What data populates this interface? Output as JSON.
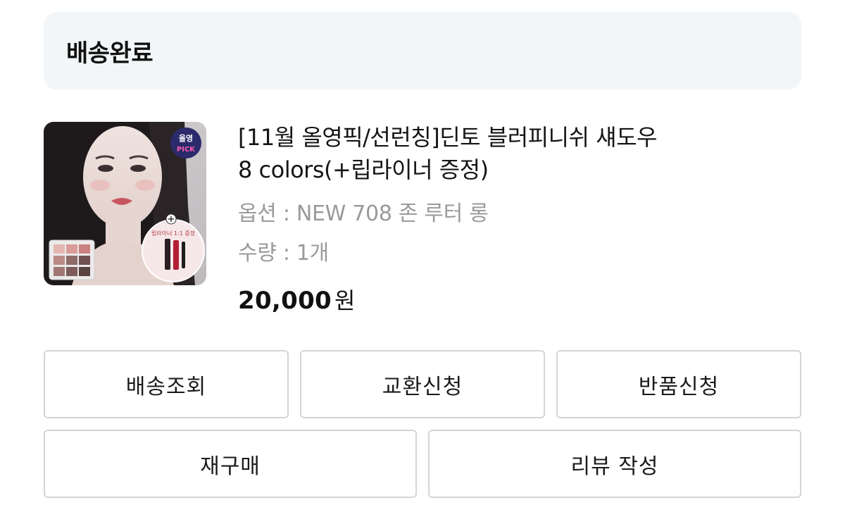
{
  "status": {
    "label": "배송완료"
  },
  "product": {
    "title_line1": "[11월 올영픽/선런칭]딘토 블러피니쉬 섀도우",
    "title_line2": "8 colors(+립라이너 증정)",
    "option": "옵션 : NEW 708 존 루터 롱",
    "quantity": "수량 : 1개",
    "price": "20,000",
    "price_unit": "원",
    "thumbnail": {
      "badge_top": "올영",
      "badge_bottom": "PICK",
      "gift_text": "립라이너 1:1 증정"
    }
  },
  "actions": {
    "track": "배송조회",
    "exchange": "교환신청",
    "return": "반품신청",
    "rebuy": "재구매",
    "review": "리뷰 작성"
  }
}
